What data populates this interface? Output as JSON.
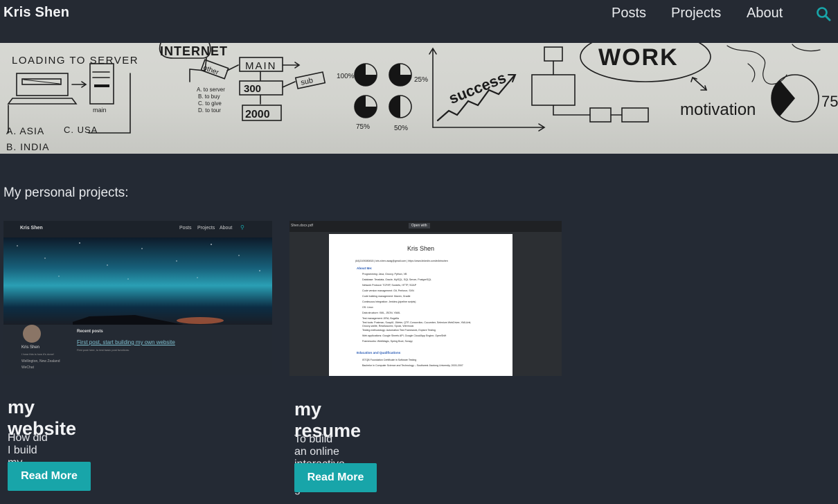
{
  "site": {
    "brand": "Kris Shen"
  },
  "nav": {
    "items": [
      "Posts",
      "Projects",
      "About"
    ],
    "search_icon": "search-icon",
    "accent": "#18a5a9"
  },
  "hero": {
    "texts": {
      "loading": "LOADING TO SERVER",
      "internet": "INTERNET",
      "main": "MAIN",
      "other": "other",
      "sub": "sub",
      "num300": "300",
      "num2000": "2000",
      "pct100": "100%",
      "pct25": "25%",
      "pct75": "75%",
      "pct50": "50%",
      "success": "success",
      "work": "WORK",
      "motivation": "motivation",
      "asia": "A. ASIA",
      "usa": "C. USA",
      "india": "B. INDIA",
      "main_small": "main",
      "to_server": "A. to server",
      "to_b": "B. to buy",
      "to_c": "C. to give",
      "to_d": "D. to tour",
      "pct_right": "75"
    }
  },
  "projects": {
    "heading": "My personal projects:",
    "items": [
      {
        "title": "my website",
        "desc": "How did I build my personal website?",
        "button": "Read More",
        "thumb": {
          "brand": "Kris Shen",
          "nav": [
            "Posts",
            "Projects",
            "About"
          ],
          "recent": "Recent posts",
          "post": "First post, start building my own website",
          "post_sub": "First post here, to test basic post functions.",
          "profile_name": "Kris Shen",
          "profile_sub": "I hear this is how it's done!",
          "location": "Wellington, New Zealand",
          "link": "WeChat"
        }
      },
      {
        "title": "my resume",
        "desc": "To build an online interactive resume generator.",
        "button": "Read More",
        "thumb": {
          "file": "Shen.docx.pdf",
          "open_with": "Open with",
          "name": "Kris Shen",
          "contact": "(64)2109280815 | kris.shen.uwag@gmail.com | https://www.linkedin.com/in/krisshen",
          "about": "About Me:",
          "bullets": [
            "Programming: Java, Groovy, Python, VB",
            "Database: Teradata, Oracle, MySQL, SQL Server, PostgreSQL",
            "Network Protocol: TCP/IP, Sockets, HTTP, SOAP",
            "Code version management: Git, Perforce, SVN",
            "Code building management: Maven, Gradle",
            "Continuous Integration: Jenkins (pipeline scripts)",
            "OS: Linux",
            "Data structure: XML, JSON, YAML",
            "Test management: JIRA, Bugzilla",
            "Test tools: Postman, SoapUI, JMeter, QTP, Concordion, Cucumber, Selenium WebDriver, XMLUnit, Groovy-wslite, RestAssured, Spock, Wiremock",
            "Testing methodology: Automation Test Framework, Explore Testing",
            "Web applications: Google Sheets API, Google Cloud/App Engine, OpenShift",
            "Frameworks: WebMagic, Spring Boot, Scrapy"
          ],
          "edu": "Education and Qualifications",
          "edu_items": [
            "ISTQB Foundation Certificate in Software Testing",
            "Bachelor in Computer Science and Technology – Southwest Jiaotong University, 2003-2007"
          ]
        }
      }
    ]
  }
}
